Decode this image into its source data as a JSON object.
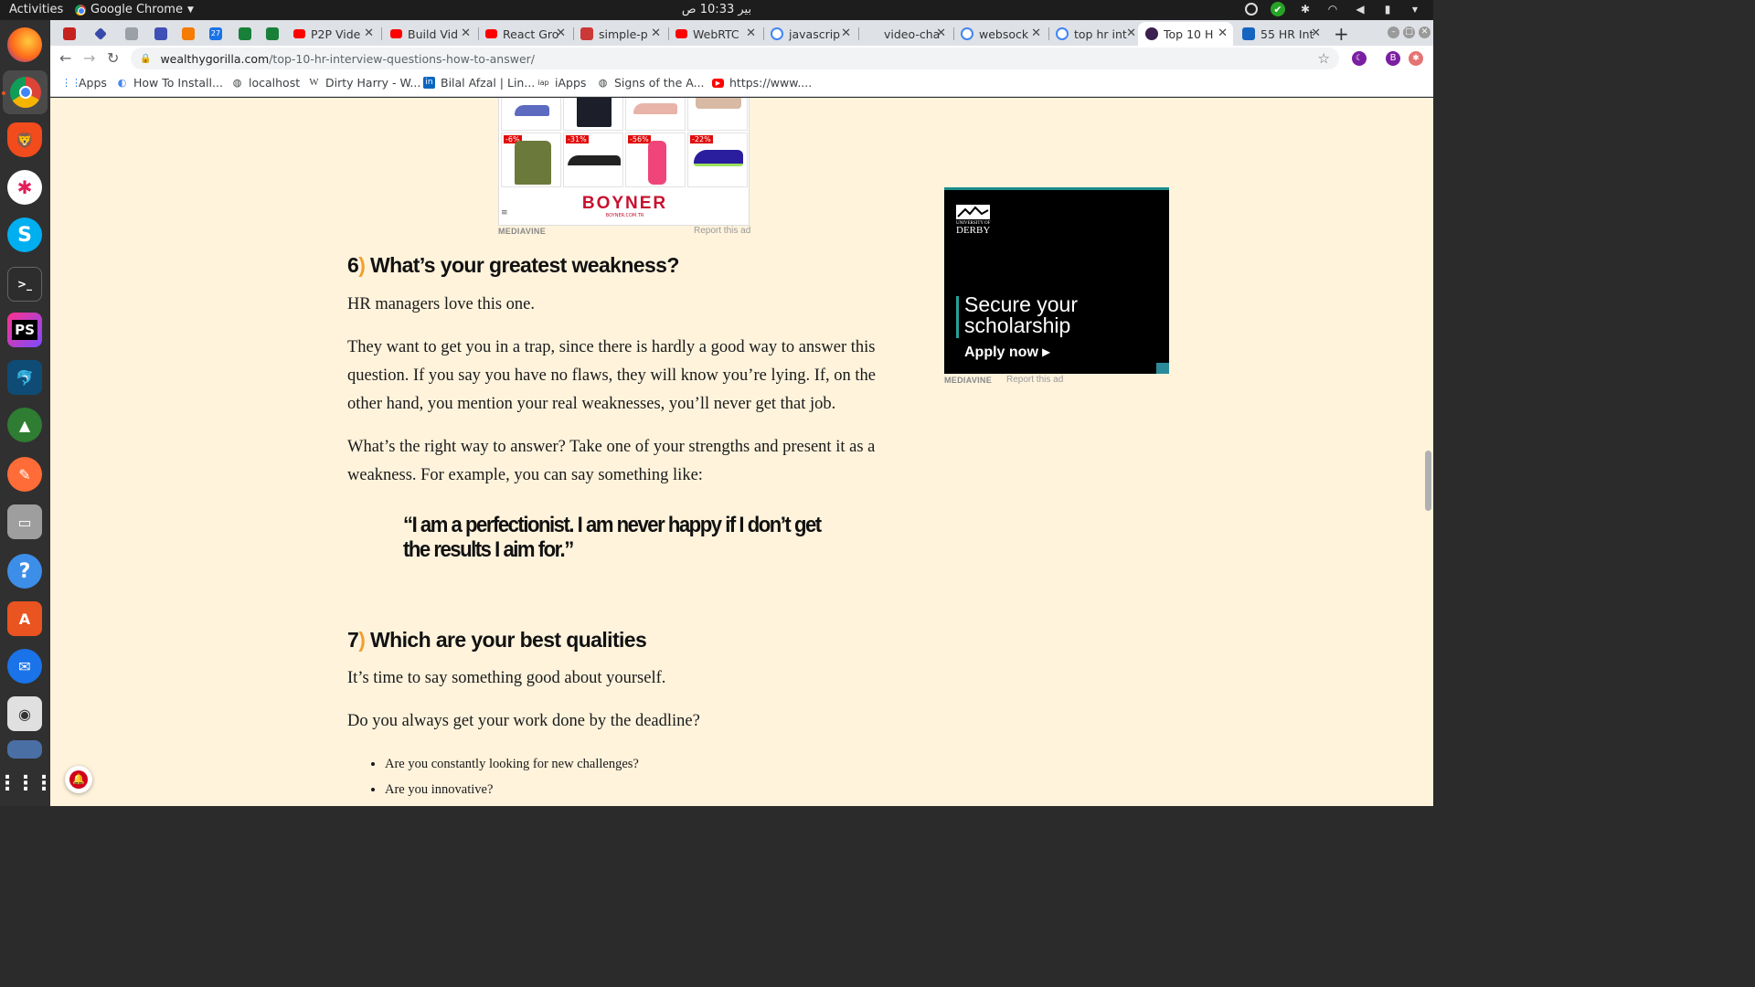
{
  "os": {
    "activities_label": "Activities",
    "app_menu_label": "Google Chrome",
    "clock": "بير 10:33 ص"
  },
  "dock": {
    "items": [
      {
        "name": "firefox"
      },
      {
        "name": "chrome"
      },
      {
        "name": "brave"
      },
      {
        "name": "slack"
      },
      {
        "name": "skype"
      },
      {
        "name": "terminal"
      },
      {
        "name": "phpstorm"
      },
      {
        "name": "mysql-workbench"
      },
      {
        "name": "robo3t"
      },
      {
        "name": "postman"
      },
      {
        "name": "files"
      },
      {
        "name": "help"
      },
      {
        "name": "software-center"
      },
      {
        "name": "thunderbird"
      },
      {
        "name": "rhythmbox"
      },
      {
        "name": "screen"
      },
      {
        "name": "show-apps"
      }
    ]
  },
  "browser": {
    "tabs": [
      {
        "label": "",
        "color": "#c5221f"
      },
      {
        "label": "",
        "color": "#3949ab"
      },
      {
        "label": "",
        "color": "#5f6368"
      },
      {
        "label": "",
        "color": "#3f51b5"
      },
      {
        "label": "",
        "color": "#f57c00"
      },
      {
        "label": "27",
        "color": "#1a73e8"
      },
      {
        "label": "",
        "color": "#188038"
      },
      {
        "label": "",
        "color": "#188038"
      },
      {
        "label": "P2P Vide",
        "color": "#ff0000"
      },
      {
        "label": "Build Vid",
        "color": "#ff0000"
      },
      {
        "label": "React Gro",
        "color": "#ff0000"
      },
      {
        "label": "simple-p",
        "color": "#cb3837"
      },
      {
        "label": "WebRTC",
        "color": "#ff0000"
      },
      {
        "label": "javascrip",
        "color": "#4285f4"
      },
      {
        "label": "video-cha",
        "color": "#333333"
      },
      {
        "label": "websock",
        "color": "#4285f4"
      },
      {
        "label": "top hr int",
        "color": "#4285f4"
      },
      {
        "label": "Top 10 H",
        "color": "#3a1f4f"
      },
      {
        "label": "55 HR Int",
        "color": "#1565c0"
      }
    ],
    "url_domain": "wealthygorilla.com",
    "url_path": "/top-10-hr-interview-questions-how-to-answer/",
    "profile_initial": "B",
    "bookmarks": [
      {
        "label": "Apps",
        "icon": "apps-grid-icon"
      },
      {
        "label": "How To Install...",
        "icon": "globe-icon"
      },
      {
        "label": "localhost",
        "icon": "globe-icon"
      },
      {
        "label": "Dirty Harry - W...",
        "icon": "wikipedia-icon"
      },
      {
        "label": "Bilal Afzal | Lin...",
        "icon": "linkedin-icon"
      },
      {
        "label": "iApps",
        "icon": "iapps-icon"
      },
      {
        "label": "Signs of the A...",
        "icon": "globe-icon"
      },
      {
        "label": "https://www....",
        "icon": "youtube-icon"
      }
    ]
  },
  "ads": {
    "boyner": {
      "discounts": [
        "-6%",
        "-31%",
        "-56%",
        "-22%"
      ],
      "brand": "BOYNER",
      "brand_url": "BOYNER.COM.TR",
      "network": "MEDIAVINE",
      "report": "Report this ad"
    },
    "derby": {
      "university_line": "UNIVERSITY OF",
      "name": "DERBY",
      "headline": "Secure your scholarship",
      "cta": "Apply now ▸",
      "network": "MEDIAVINE",
      "report": "Report this ad"
    }
  },
  "article": {
    "q6_number": "6",
    "q6_paren": ")",
    "q6_title": " What’s your greatest weakness?",
    "p1": "HR managers love this one.",
    "p2": "They want to get you in a trap, since there is hardly a good way to answer this question. If you say you have no flaws, they will know you’re lying. If, on the other hand, you mention your real weaknesses, you’ll never get that job.",
    "p3": "What’s the right way to answer? Take one of your strengths and present it as a weakness. For example, you can say something like:",
    "quote": "“I am a perfectionist. I am never happy if I don’t get the results I aim for.”",
    "q7_number": "7",
    "q7_paren": ")",
    "q7_title": " Which are your best qualities",
    "p4": "It’s time to say something good about yourself.",
    "p5": "Do you always get your work done by the deadline?",
    "bullets": [
      "Are you constantly looking for new challenges?",
      "Are you innovative?"
    ]
  }
}
